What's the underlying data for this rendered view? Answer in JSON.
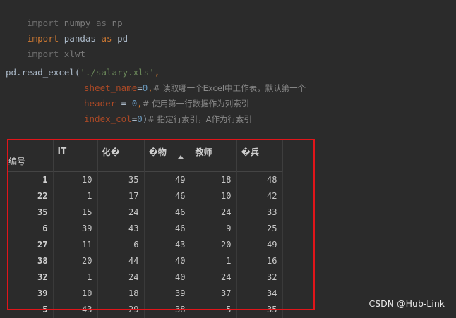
{
  "code": {
    "line1": {
      "kw": "import",
      "mod": "numpy",
      "as": "as",
      "alias": "np"
    },
    "line2": {
      "kw": "import",
      "mod": "pandas",
      "as": "as",
      "alias": "pd"
    },
    "line3": {
      "kw": "import",
      "mod": "xlwt"
    },
    "line5": {
      "call": "pd.read_excel(",
      "arg": "'./salary.xls'",
      "end": ","
    },
    "line6": {
      "param": "sheet_name",
      "eq": "=",
      "val": "0",
      "sep": ",",
      "comment": "# 读取哪一个Excel中工作表，默认第一个"
    },
    "line7": {
      "param": "header",
      "eq": " = ",
      "val": "0",
      "sep": ",",
      "comment": "# 使用第一行数据作为列索引"
    },
    "line8": {
      "param": "index_col",
      "eq": "=",
      "val": "0",
      "sep": ")",
      "comment": "# 指定行索引，A作为行索引"
    }
  },
  "table": {
    "index_header": "编号",
    "columns": [
      "IT",
      "化�",
      "�物",
      "教师",
      "�兵"
    ],
    "rows": [
      {
        "idx": "1",
        "values": [
          "10",
          "35",
          "49",
          "18",
          "48"
        ]
      },
      {
        "idx": "22",
        "values": [
          "1",
          "17",
          "46",
          "10",
          "42"
        ]
      },
      {
        "idx": "35",
        "values": [
          "15",
          "24",
          "46",
          "24",
          "33"
        ]
      },
      {
        "idx": "6",
        "values": [
          "39",
          "43",
          "46",
          "9",
          "25"
        ]
      },
      {
        "idx": "27",
        "values": [
          "11",
          "6",
          "43",
          "20",
          "49"
        ]
      },
      {
        "idx": "38",
        "values": [
          "20",
          "44",
          "40",
          "1",
          "16"
        ]
      },
      {
        "idx": "32",
        "values": [
          "1",
          "24",
          "40",
          "24",
          "32"
        ]
      },
      {
        "idx": "39",
        "values": [
          "10",
          "18",
          "39",
          "37",
          "34"
        ]
      },
      {
        "idx": "5",
        "values": [
          "43",
          "29",
          "38",
          "5",
          "35"
        ]
      }
    ]
  },
  "watermark": "CSDN @Hub-Link",
  "colors": {
    "highlight_border": "#e0151a",
    "background": "#2b2b2b"
  }
}
